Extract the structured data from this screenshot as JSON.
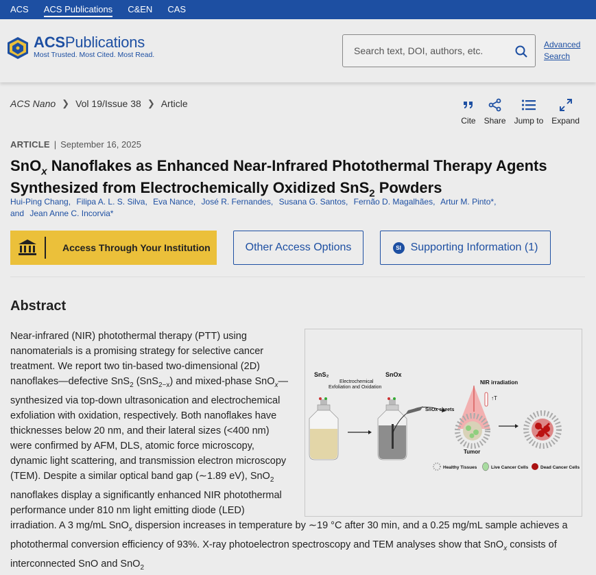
{
  "topnav": {
    "items": [
      "ACS",
      "ACS Publications",
      "C&EN",
      "CAS"
    ],
    "active_index": 1
  },
  "header": {
    "logo_title_bold": "ACS",
    "logo_title_rest": "Publications",
    "logo_tagline": "Most Trusted. Most Cited. Most Read.",
    "search_placeholder": "Search text, DOI, authors, etc.",
    "advanced_search": [
      "Advanced",
      "Search"
    ]
  },
  "breadcrumb": {
    "journal": "ACS Nano",
    "issue": "Vol 19/Issue 38",
    "type": "Article"
  },
  "tools": {
    "cite": "Cite",
    "share": "Share",
    "jump": "Jump to",
    "expand": "Expand"
  },
  "article": {
    "type": "ARTICLE",
    "date": "September 16, 2025",
    "title_line1_a": "SnO",
    "title_line1_sub": "x",
    "title_line1_b": " Nanoflakes as Enhanced Near-Infrared Photothermal Therapy Agents",
    "title_line2_a": "Synthesized from Electrochemically Oxidized SnS",
    "title_line2_sub": "2",
    "title_line2_b": " Powders",
    "authors": [
      "Hui-Ping Chang,",
      "Filipa A. L. S. Silva,",
      "Eva Nance,",
      "José R. Fernandes,",
      "Susana G. Santos,",
      "Fernão D. Magalhães,",
      "Artur M. Pinto*,",
      "and",
      "Jean Anne C. Incorvia*"
    ]
  },
  "buttons": {
    "institution": "Access Through Your Institution",
    "other": "Other Access Options",
    "si_badge": "SI",
    "supporting": "Supporting Information (1)"
  },
  "abstract": {
    "heading": "Abstract",
    "text": {
      "p1": "Near-infrared (NIR) photothermal therapy (PTT) using nanomaterials is a promising strategy for selective cancer treatment. We report two tin-based two-dimensional (2D) nanoflakes—defective SnS",
      "p1_sub1": "2",
      "p1_b": " (SnS",
      "p1_sub2": "2−x",
      "p1_c": ") and mixed-phase SnO",
      "p1_sub3": "x",
      "p1_d": "—synthesized via top-down ultrasonication and electrochemical exfoliation with oxidation, respectively. Both nanoflakes have thicknesses below 20 nm, and their lateral sizes (<400 nm) were confirmed by AFM, DLS, atomic force microscopy, dynamic light scattering, and transmission electron microscopy (TEM). Despite a similar optical band gap (∼1.89 eV), SnO",
      "p1_sub4": "2",
      "p1_e": " nanoflakes display a significantly enhanced NIR photothermal performance under 810 nm light emitting diode (LED) irradiation. A 3 mg/mL SnO",
      "p1_sub5": "x",
      "p1_f": " dispersion increases in temperature by ∼19 °C after 30 min, and a 0.25 mg/mL sample achieves a photothermal conversion efficiency of 93%. X-ray photoelectron spectroscopy and TEM analyses show that SnO",
      "p1_sub6": "x",
      "p1_g": " consists of interconnected SnO and SnO",
      "p1_sub7": "2"
    }
  },
  "figure": {
    "sns2": "SnS₂",
    "snox": "SnOx",
    "process_1": "Electrochemical",
    "process_2": "Exfoliation and Oxidation",
    "sheets": "SnOx sheets",
    "nir": "NIR irradiation",
    "temp": "↑T",
    "tumor": "Tumor",
    "legend_healthy": "Healthy Tissues",
    "legend_live": "Live Cancer Cells",
    "legend_dead": "Dead Cancer Cells"
  },
  "colors": {
    "brand_blue": "#1d4fa2",
    "accent_yellow": "#ebc03a",
    "background": "#ececec"
  }
}
